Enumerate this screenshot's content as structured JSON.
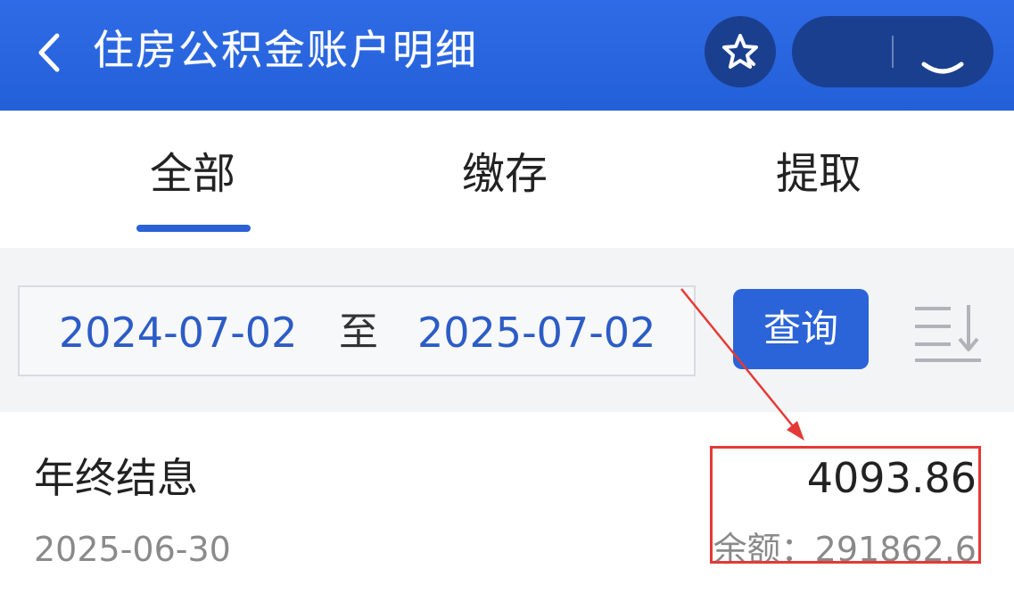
{
  "header": {
    "title": "住房公积金账户明细",
    "back_icon": "chevron-left-icon",
    "favorite_icon": "star-icon",
    "more_icon": "more-icon",
    "close_icon": "close-icon",
    "background_color": "#2260d8"
  },
  "tabs": [
    {
      "label": "全部",
      "active": true
    },
    {
      "label": "缴存",
      "active": false
    },
    {
      "label": "提取",
      "active": false
    }
  ],
  "filter": {
    "start_date": "2024-07-02",
    "separator": "至",
    "end_date": "2025-07-02",
    "query_label": "查询",
    "sort_icon": "sort-descending-icon",
    "accent_color": "#2b64d8"
  },
  "records": [
    {
      "title": "年终结息",
      "date": "2025-06-30",
      "amount": "4093.86",
      "balance": "余额：291862.6"
    }
  ],
  "annotation": {
    "color": "#e53935",
    "type": "red-highlight-box-with-arrow"
  }
}
